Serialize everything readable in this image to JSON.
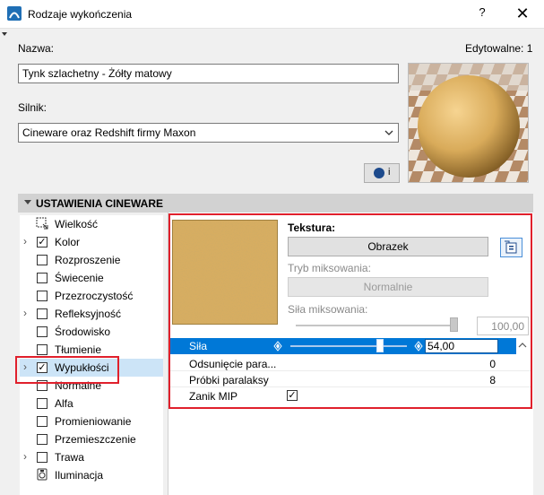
{
  "window": {
    "title": "Rodzaje wykończenia",
    "help": "?",
    "close": "✕"
  },
  "form": {
    "name_label": "Nazwa:",
    "editable": "Edytowalne: 1",
    "name_value": "Tynk szlachetny - Żółty matowy",
    "engine_label": "Silnik:",
    "engine_value": "Cineware oraz Redshift firmy Maxon",
    "info_btn": "i"
  },
  "section": {
    "title": "USTAWIENIA CINEWARE"
  },
  "channels": [
    {
      "label": "Wielkość",
      "expand": "",
      "checkbox": "none",
      "icon": "resize-icon"
    },
    {
      "label": "Kolor",
      "expand": "›",
      "checkbox": "checked"
    },
    {
      "label": "Rozproszenie",
      "expand": "",
      "checkbox": "unchecked"
    },
    {
      "label": "Świecenie",
      "expand": "",
      "checkbox": "unchecked"
    },
    {
      "label": "Przezroczystość",
      "expand": "",
      "checkbox": "unchecked"
    },
    {
      "label": "Refleksyjność",
      "expand": "›",
      "checkbox": "unchecked"
    },
    {
      "label": "Środowisko",
      "expand": "",
      "checkbox": "unchecked"
    },
    {
      "label": "Tłumienie",
      "expand": "",
      "checkbox": "unchecked"
    },
    {
      "label": "Wypukłości",
      "expand": "›",
      "checkbox": "checked",
      "selected": true
    },
    {
      "label": "Normalne",
      "expand": "",
      "checkbox": "unchecked"
    },
    {
      "label": "Alfa",
      "expand": "",
      "checkbox": "unchecked"
    },
    {
      "label": "Promieniowanie",
      "expand": "",
      "checkbox": "unchecked"
    },
    {
      "label": "Przemieszczenie",
      "expand": "",
      "checkbox": "unchecked"
    },
    {
      "label": "Trawa",
      "expand": "›",
      "checkbox": "unchecked"
    },
    {
      "label": "Iluminacja",
      "expand": "",
      "checkbox": "none",
      "icon": "illumination-icon"
    }
  ],
  "texture": {
    "label": "Tekstura:",
    "image_btn": "Obrazek",
    "mix_mode_label": "Tryb miksowania:",
    "mix_mode_value": "Normalnie",
    "mix_strength_label": "Siła miksowania:",
    "mix_strength_value": "100,00",
    "mix_strength_fraction": 1.0
  },
  "params": {
    "strength_label": "Siła",
    "strength_value": "54,00",
    "strength_fraction": 0.54,
    "rows": [
      {
        "label": "Odsunięcie para...",
        "value": "0"
      },
      {
        "label": "Próbki paralaksy",
        "value": "8"
      },
      {
        "label": "Zanik MIP",
        "value": ""
      }
    ],
    "mip_checked": true
  },
  "colors": {
    "accent": "#0078d7",
    "highlight": "#e0202c",
    "texture": "#d9ab5a"
  }
}
